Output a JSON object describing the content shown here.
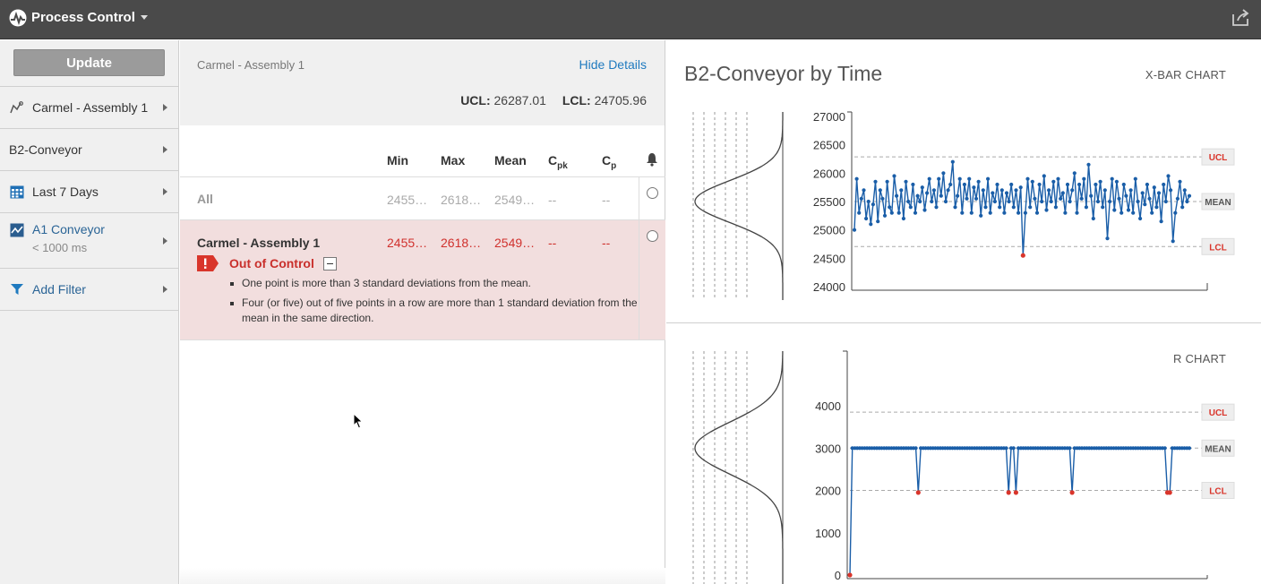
{
  "app": {
    "title": "Process Control",
    "logo_icon": "process-logo-icon",
    "export_icon": "export-icon"
  },
  "sidebar": {
    "update_label": "Update",
    "items": [
      {
        "label": "Carmel - Assembly 1",
        "icon": "line-chart-icon"
      },
      {
        "label": "B2-Conveyor",
        "icon": ""
      },
      {
        "label": "Last 7 Days",
        "icon": "calendar-icon"
      },
      {
        "label": "A1 Conveyor",
        "sublabel": "< 1000 ms",
        "icon": "trend-icon"
      },
      {
        "label": "Add Filter",
        "icon": "filter-icon"
      }
    ]
  },
  "details": {
    "breadcrumb": "Carmel - Assembly 1",
    "hide_details": "Hide Details",
    "ucl_label": "UCL:",
    "ucl_value": "26287.01",
    "lcl_label": "LCL:",
    "lcl_value": "24705.96",
    "columns": [
      "Min",
      "Max",
      "Mean",
      "C",
      "C"
    ],
    "col_subs": [
      "",
      "",
      "",
      "pk",
      "p"
    ],
    "rows": [
      {
        "label": "All",
        "min": "2455…",
        "max": "2618…",
        "mean": "2549…",
        "cpk": "--",
        "cp": "--"
      },
      {
        "label": "Carmel - Assembly 1",
        "min": "2455…",
        "max": "2618…",
        "mean": "2549…",
        "cpk": "--",
        "cp": "--",
        "status": "Out of Control",
        "rules": [
          "One point is more than 3 standard deviations from the mean.",
          "Four (or five) out of five points in a row are more than 1 standard deviation from the mean in the same direction."
        ]
      }
    ]
  },
  "colors": {
    "series": "#1a5ea8",
    "violation": "#d9352b",
    "status_bg": "#f2dede",
    "status_text": "#c9302c"
  },
  "charts": {
    "title": "B2-Conveyor by Time",
    "xbar_label": "X-BAR CHART",
    "r_label": "R CHART",
    "tags": {
      "ucl": "UCL",
      "mean": "MEAN",
      "lcl": "LCL"
    }
  },
  "chart_data": [
    {
      "type": "line",
      "name": "X-BAR CHART",
      "yticks": [
        24000,
        24500,
        25000,
        25500,
        26000,
        26500,
        27000
      ],
      "ylim": [
        24000,
        27000
      ],
      "ucl": 26287.01,
      "mean": 25500,
      "lcl": 24705.96,
      "grid": false,
      "values": [
        25000,
        25900,
        25300,
        25550,
        25700,
        25200,
        25500,
        25100,
        25450,
        25850,
        25150,
        25700,
        25550,
        25250,
        25850,
        25400,
        25300,
        25950,
        25600,
        25300,
        25700,
        25200,
        25850,
        25500,
        25400,
        25800,
        25300,
        25600,
        25500,
        25750,
        25350,
        25650,
        25900,
        25500,
        25700,
        25400,
        25900,
        25600,
        26000,
        25500,
        25700,
        25800,
        26200,
        25400,
        25600,
        25900,
        25300,
        25800,
        25550,
        25900,
        25300,
        25750,
        25550,
        25850,
        25250,
        25700,
        25400,
        25900,
        25300,
        25650,
        25500,
        25800,
        25400,
        25700,
        25300,
        25650,
        25500,
        25800,
        25400,
        25700,
        25300,
        25750,
        24550,
        25300,
        25900,
        25400,
        25850,
        25550,
        25300,
        25800,
        25500,
        25950,
        25350,
        25700,
        25500,
        25850,
        25400,
        25900,
        25550,
        25650,
        25300,
        25800,
        25500,
        25700,
        26000,
        25300,
        25800,
        25550,
        25900,
        25400,
        26150,
        25600,
        25200,
        25800,
        25500,
        25850,
        25400,
        25700,
        24850,
        25500,
        25900,
        25350,
        25850,
        25550,
        25300,
        25800,
        25600,
        25350,
        25700,
        25300,
        25900,
        25500,
        25200,
        25650,
        25450,
        25800,
        25550,
        25300,
        25750,
        25400,
        25650,
        25150,
        25800,
        25500,
        25950,
        25700,
        24800,
        25300,
        25550,
        25850,
        25400,
        25700,
        25500,
        25600
      ],
      "violations": [
        72
      ]
    },
    {
      "type": "line",
      "name": "R CHART",
      "yticks": [
        0,
        1000,
        2000,
        3000,
        4000
      ],
      "ylim": [
        0,
        4700
      ],
      "ucl": 3850,
      "mean": 3000,
      "lcl": 2000,
      "grid": false,
      "n_points": 140,
      "baseline": 3000,
      "overrides": [
        {
          "i": 0,
          "v": 0
        },
        {
          "i": 28,
          "v": 1950
        },
        {
          "i": 65,
          "v": 1950
        },
        {
          "i": 68,
          "v": 1950
        },
        {
          "i": 91,
          "v": 1950
        },
        {
          "i": 130,
          "v": 1950
        },
        {
          "i": 131,
          "v": 1950
        }
      ],
      "violations": [
        0,
        28,
        65,
        68,
        91,
        130,
        131
      ]
    }
  ]
}
